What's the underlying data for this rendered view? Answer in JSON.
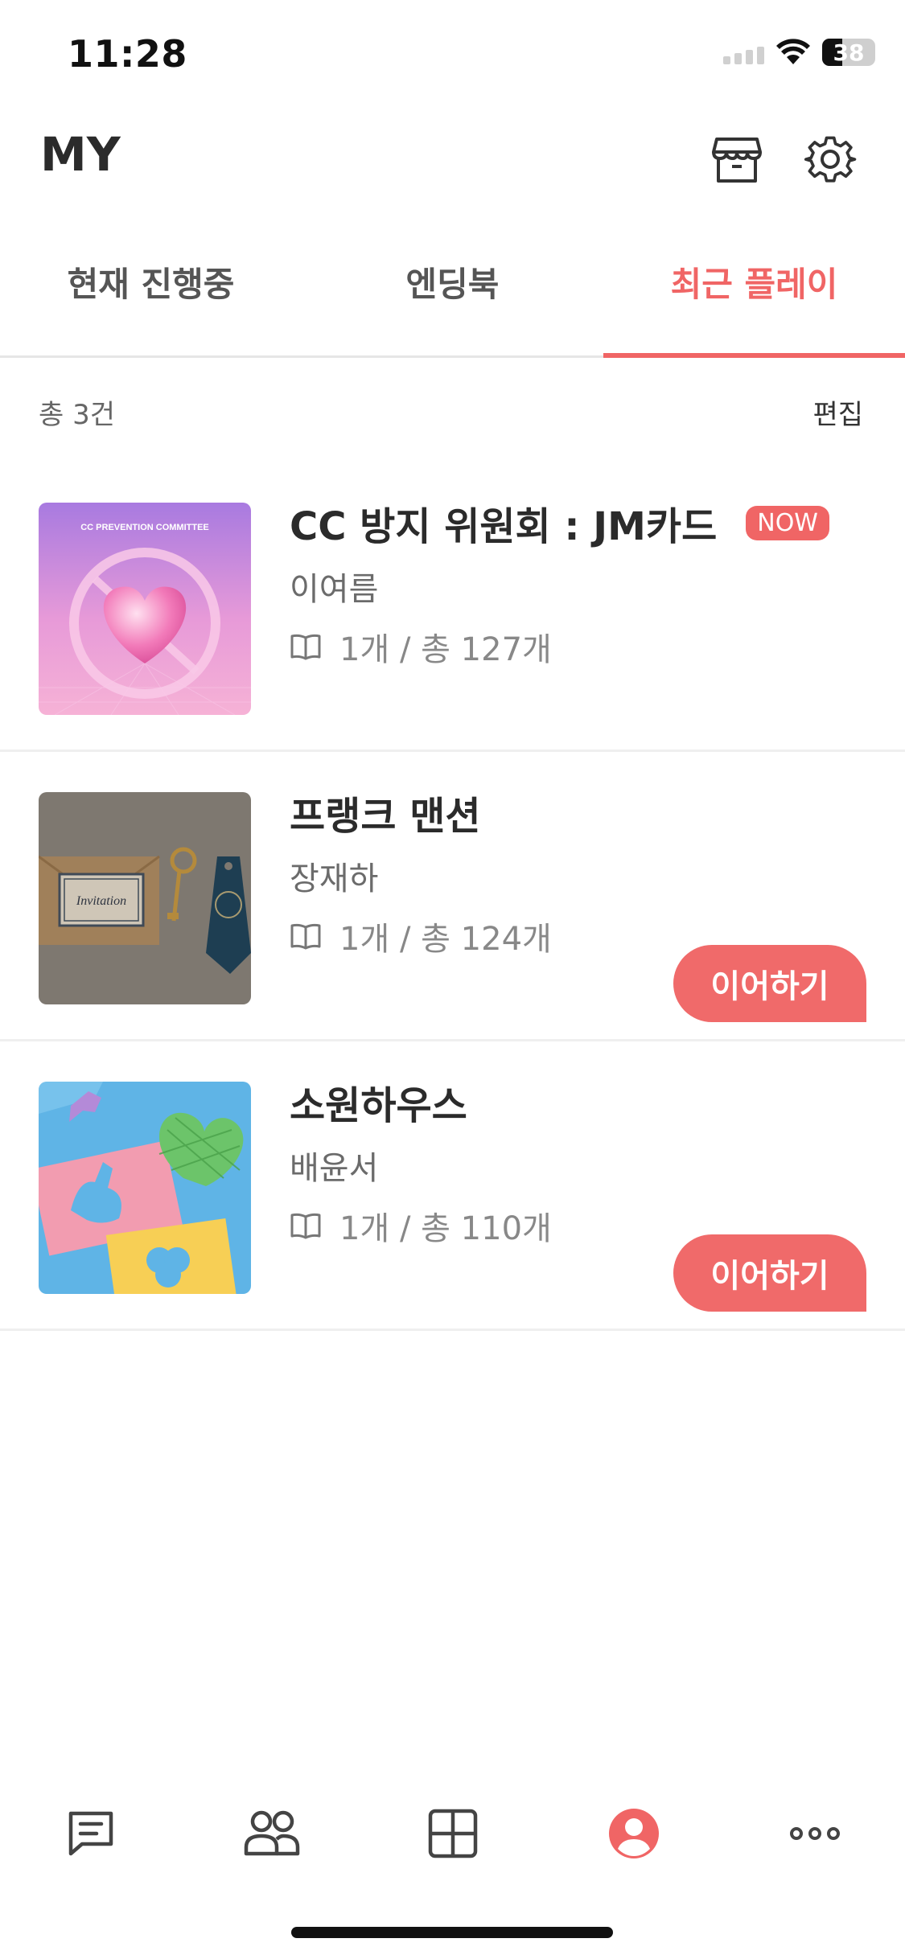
{
  "status": {
    "time": "11:28",
    "battery": "38",
    "battery_level": 0.38
  },
  "header": {
    "title": "MY",
    "store_icon": "store-icon",
    "settings_icon": "gear-icon"
  },
  "tabs": [
    {
      "label": "현재 진행중",
      "active": false
    },
    {
      "label": "엔딩북",
      "active": false
    },
    {
      "label": "최근 플레이",
      "active": true
    }
  ],
  "summary": {
    "count": "총 3건",
    "edit": "편집"
  },
  "items": [
    {
      "title": "CC 방지 위원회 : JM카드",
      "badge": "NOW",
      "author": "이여름",
      "progress": "1개 / 총 127개",
      "thumb_text": "CC PREVENTION COMMITTEE"
    },
    {
      "title": "프랭크 맨션",
      "author": "장재하",
      "progress": "1개 / 총 124개",
      "button": "이어하기",
      "thumb_text": "Invitation"
    },
    {
      "title": "소원하우스",
      "author": "배윤서",
      "progress": "1개 / 총 110개",
      "button": "이어하기"
    }
  ],
  "nav": [
    {
      "name": "chat-icon",
      "active": false
    },
    {
      "name": "friends-icon",
      "active": false
    },
    {
      "name": "grid-icon",
      "active": false
    },
    {
      "name": "profile-icon",
      "active": true
    },
    {
      "name": "more-icon",
      "active": false
    }
  ],
  "colors": {
    "accent": "#f06565",
    "text": "#2b2b2b",
    "muted": "#888888"
  }
}
